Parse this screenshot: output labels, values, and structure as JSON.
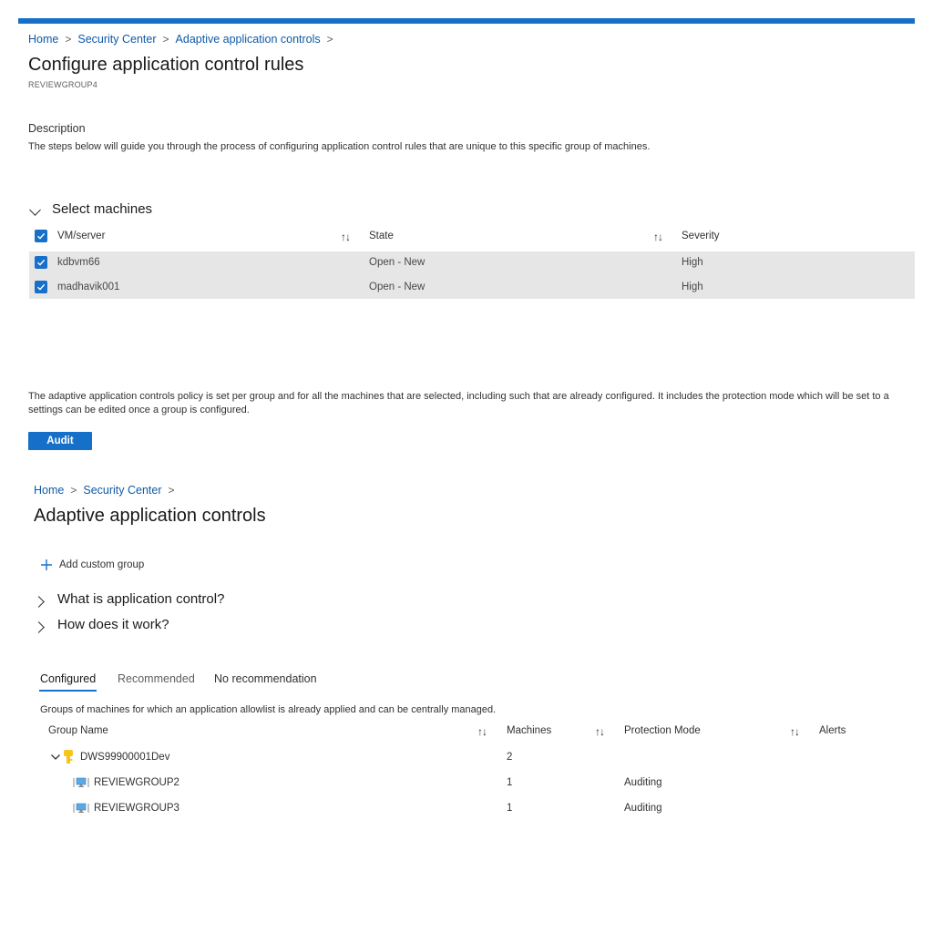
{
  "top": {
    "breadcrumb": [
      "Home",
      "Security Center",
      "Adaptive application controls"
    ],
    "title": "Configure application control rules",
    "subtitle": "REVIEWGROUP4",
    "description_label": "Description",
    "description_text": "The steps below will guide you through the process of configuring application control rules that are unique to this specific group of machines.",
    "section_title": "Select machines",
    "table": {
      "headers": [
        "VM/server",
        "State",
        "Severity"
      ],
      "rows": [
        {
          "vm": "kdbvm66",
          "state": "Open - New",
          "severity": "High",
          "checked": true
        },
        {
          "vm": "madhavik001",
          "state": "Open - New",
          "severity": "High",
          "checked": true
        }
      ]
    },
    "policy_line1": "The adaptive application controls policy is set per group and for all the machines that are selected, including such that are already configured. It includes the protection mode which will be set to a",
    "policy_line2": "settings can be edited once a group is configured.",
    "audit_button": "Audit"
  },
  "bottom": {
    "breadcrumb": [
      "Home",
      "Security Center"
    ],
    "title": "Adaptive application controls",
    "add_group": "Add custom group",
    "expanders": [
      "What is application control?",
      "How does it work?"
    ],
    "tabs": [
      "Configured",
      "Recommended",
      "No recommendation"
    ],
    "active_tab": "Configured",
    "tab_description": "Groups of machines for which an application allowlist is already applied and can be centrally managed.",
    "table": {
      "headers": [
        "Group Name",
        "Machines",
        "Protection Mode",
        "Alerts"
      ],
      "parent": {
        "name": "DWS99900001Dev",
        "machines": "2"
      },
      "children": [
        {
          "name": "REVIEWGROUP2",
          "machines": "1",
          "mode": "Auditing"
        },
        {
          "name": "REVIEWGROUP3",
          "machines": "1",
          "mode": "Auditing"
        }
      ]
    }
  },
  "colors": {
    "accent": "#1670c9",
    "row_selected": "#e6e6e6",
    "key_icon": "#f5c518"
  }
}
